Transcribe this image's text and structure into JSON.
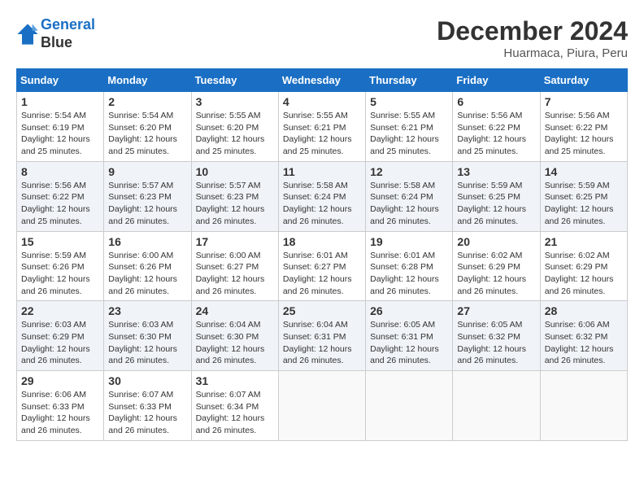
{
  "header": {
    "logo_line1": "General",
    "logo_line2": "Blue",
    "month": "December 2024",
    "location": "Huarmaca, Piura, Peru"
  },
  "weekdays": [
    "Sunday",
    "Monday",
    "Tuesday",
    "Wednesday",
    "Thursday",
    "Friday",
    "Saturday"
  ],
  "weeks": [
    [
      {
        "day": "1",
        "sunrise": "5:54 AM",
        "sunset": "6:19 PM",
        "daylight": "12 hours and 25 minutes."
      },
      {
        "day": "2",
        "sunrise": "5:54 AM",
        "sunset": "6:20 PM",
        "daylight": "12 hours and 25 minutes."
      },
      {
        "day": "3",
        "sunrise": "5:55 AM",
        "sunset": "6:20 PM",
        "daylight": "12 hours and 25 minutes."
      },
      {
        "day": "4",
        "sunrise": "5:55 AM",
        "sunset": "6:21 PM",
        "daylight": "12 hours and 25 minutes."
      },
      {
        "day": "5",
        "sunrise": "5:55 AM",
        "sunset": "6:21 PM",
        "daylight": "12 hours and 25 minutes."
      },
      {
        "day": "6",
        "sunrise": "5:56 AM",
        "sunset": "6:22 PM",
        "daylight": "12 hours and 25 minutes."
      },
      {
        "day": "7",
        "sunrise": "5:56 AM",
        "sunset": "6:22 PM",
        "daylight": "12 hours and 25 minutes."
      }
    ],
    [
      {
        "day": "8",
        "sunrise": "5:56 AM",
        "sunset": "6:22 PM",
        "daylight": "12 hours and 25 minutes."
      },
      {
        "day": "9",
        "sunrise": "5:57 AM",
        "sunset": "6:23 PM",
        "daylight": "12 hours and 26 minutes."
      },
      {
        "day": "10",
        "sunrise": "5:57 AM",
        "sunset": "6:23 PM",
        "daylight": "12 hours and 26 minutes."
      },
      {
        "day": "11",
        "sunrise": "5:58 AM",
        "sunset": "6:24 PM",
        "daylight": "12 hours and 26 minutes."
      },
      {
        "day": "12",
        "sunrise": "5:58 AM",
        "sunset": "6:24 PM",
        "daylight": "12 hours and 26 minutes."
      },
      {
        "day": "13",
        "sunrise": "5:59 AM",
        "sunset": "6:25 PM",
        "daylight": "12 hours and 26 minutes."
      },
      {
        "day": "14",
        "sunrise": "5:59 AM",
        "sunset": "6:25 PM",
        "daylight": "12 hours and 26 minutes."
      }
    ],
    [
      {
        "day": "15",
        "sunrise": "5:59 AM",
        "sunset": "6:26 PM",
        "daylight": "12 hours and 26 minutes."
      },
      {
        "day": "16",
        "sunrise": "6:00 AM",
        "sunset": "6:26 PM",
        "daylight": "12 hours and 26 minutes."
      },
      {
        "day": "17",
        "sunrise": "6:00 AM",
        "sunset": "6:27 PM",
        "daylight": "12 hours and 26 minutes."
      },
      {
        "day": "18",
        "sunrise": "6:01 AM",
        "sunset": "6:27 PM",
        "daylight": "12 hours and 26 minutes."
      },
      {
        "day": "19",
        "sunrise": "6:01 AM",
        "sunset": "6:28 PM",
        "daylight": "12 hours and 26 minutes."
      },
      {
        "day": "20",
        "sunrise": "6:02 AM",
        "sunset": "6:29 PM",
        "daylight": "12 hours and 26 minutes."
      },
      {
        "day": "21",
        "sunrise": "6:02 AM",
        "sunset": "6:29 PM",
        "daylight": "12 hours and 26 minutes."
      }
    ],
    [
      {
        "day": "22",
        "sunrise": "6:03 AM",
        "sunset": "6:29 PM",
        "daylight": "12 hours and 26 minutes."
      },
      {
        "day": "23",
        "sunrise": "6:03 AM",
        "sunset": "6:30 PM",
        "daylight": "12 hours and 26 minutes."
      },
      {
        "day": "24",
        "sunrise": "6:04 AM",
        "sunset": "6:30 PM",
        "daylight": "12 hours and 26 minutes."
      },
      {
        "day": "25",
        "sunrise": "6:04 AM",
        "sunset": "6:31 PM",
        "daylight": "12 hours and 26 minutes."
      },
      {
        "day": "26",
        "sunrise": "6:05 AM",
        "sunset": "6:31 PM",
        "daylight": "12 hours and 26 minutes."
      },
      {
        "day": "27",
        "sunrise": "6:05 AM",
        "sunset": "6:32 PM",
        "daylight": "12 hours and 26 minutes."
      },
      {
        "day": "28",
        "sunrise": "6:06 AM",
        "sunset": "6:32 PM",
        "daylight": "12 hours and 26 minutes."
      }
    ],
    [
      {
        "day": "29",
        "sunrise": "6:06 AM",
        "sunset": "6:33 PM",
        "daylight": "12 hours and 26 minutes."
      },
      {
        "day": "30",
        "sunrise": "6:07 AM",
        "sunset": "6:33 PM",
        "daylight": "12 hours and 26 minutes."
      },
      {
        "day": "31",
        "sunrise": "6:07 AM",
        "sunset": "6:34 PM",
        "daylight": "12 hours and 26 minutes."
      },
      null,
      null,
      null,
      null
    ]
  ]
}
